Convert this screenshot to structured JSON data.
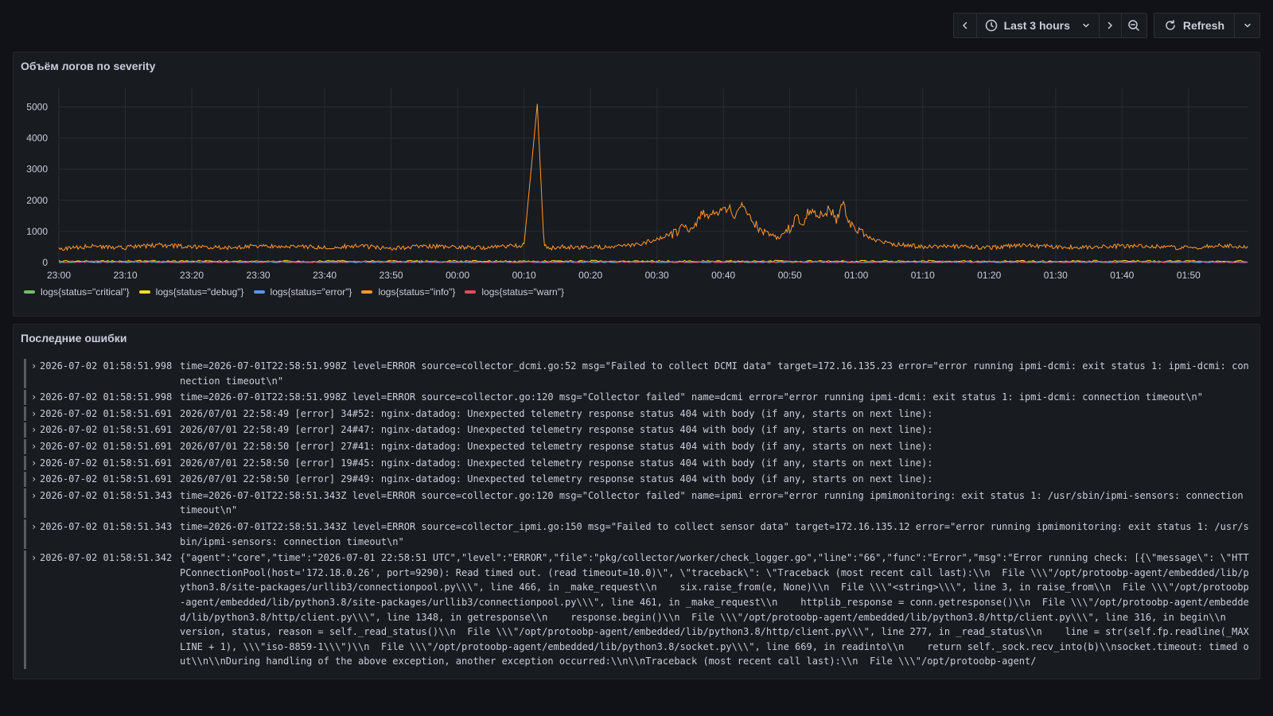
{
  "toolbar": {
    "time_range": "Last 3 hours",
    "refresh_label": "Refresh"
  },
  "chart_panel": {
    "title": "Объём логов по severity"
  },
  "chart_data": {
    "type": "line",
    "x_ticks": [
      "23:00",
      "23:10",
      "23:20",
      "23:30",
      "23:40",
      "23:50",
      "00:00",
      "00:10",
      "00:20",
      "00:30",
      "00:40",
      "00:50",
      "01:00",
      "01:10",
      "01:20",
      "01:30",
      "01:40",
      "01:50"
    ],
    "y_ticks": [
      0,
      1000,
      2000,
      3000,
      4000,
      5000
    ],
    "ylim": [
      0,
      5600
    ],
    "x_range_minutes": [
      0,
      179
    ],
    "grid": true,
    "legend_position": "bottom-left",
    "series": [
      {
        "name": "logs{status=\"critical\"}",
        "color": "#73bf69",
        "x_min": [
          0,
          179
        ],
        "values_level": [
          15,
          15
        ]
      },
      {
        "name": "logs{status=\"debug\"}",
        "color": "#fade2a",
        "x_min": [
          0,
          179
        ],
        "values_level": [
          40,
          40
        ]
      },
      {
        "name": "logs{status=\"error\"}",
        "color": "#5794f2",
        "x_min": [
          0,
          179
        ],
        "values_level": [
          10,
          10
        ]
      },
      {
        "name": "logs{status=\"info\"}",
        "color": "#ff9830",
        "x_min": [
          0,
          5,
          10,
          15,
          20,
          25,
          30,
          35,
          40,
          45,
          50,
          55,
          60,
          65,
          70,
          72,
          73,
          74,
          75,
          80,
          85,
          88,
          90,
          92,
          94,
          95,
          96,
          97,
          98,
          100,
          101,
          102,
          103,
          104,
          105,
          106,
          107,
          108,
          109,
          110,
          111,
          112,
          113,
          114,
          115,
          116,
          117,
          118,
          119,
          120,
          121,
          122,
          123,
          125,
          128,
          130,
          135,
          140,
          145,
          150,
          155,
          160,
          165,
          170,
          175,
          179
        ],
        "values": [
          450,
          520,
          480,
          560,
          500,
          470,
          540,
          510,
          490,
          530,
          460,
          520,
          500,
          480,
          560,
          5100,
          520,
          470,
          500,
          480,
          520,
          620,
          750,
          900,
          1100,
          1000,
          1300,
          1600,
          1450,
          1800,
          1700,
          1500,
          1850,
          1400,
          1200,
          900,
          1000,
          800,
          900,
          1100,
          1500,
          1300,
          1700,
          1600,
          1500,
          1750,
          1400,
          1850,
          1300,
          1000,
          900,
          800,
          700,
          600,
          550,
          500,
          520,
          480,
          560,
          500,
          490,
          530,
          510,
          470,
          540,
          500
        ]
      },
      {
        "name": "logs{status=\"warn\"}",
        "color": "#f2495c",
        "x_min": [
          0,
          179
        ],
        "values_level": [
          25,
          25
        ]
      }
    ]
  },
  "logs_panel": {
    "title": "Последние ошибки",
    "rows": [
      {
        "ts": "2026-07-02 01:58:51.998",
        "msg": "time=2026-07-01T22:58:51.998Z level=ERROR source=collector_dcmi.go:52 msg=\"Failed to collect DCMI data\" target=172.16.135.23 error=\"error running ipmi-dcmi: exit status 1: ipmi-dcmi: connection timeout\\n\""
      },
      {
        "ts": "2026-07-02 01:58:51.998",
        "msg": "time=2026-07-01T22:58:51.998Z level=ERROR source=collector.go:120 msg=\"Collector failed\" name=dcmi error=\"error running ipmi-dcmi: exit status 1: ipmi-dcmi: connection timeout\\n\""
      },
      {
        "ts": "2026-07-02 01:58:51.691",
        "msg": "2026/07/01 22:58:49 [error] 34#52: nginx-datadog: Unexpected telemetry response status 404 with body (if any, starts on next line):"
      },
      {
        "ts": "2026-07-02 01:58:51.691",
        "msg": "2026/07/01 22:58:49 [error] 24#47: nginx-datadog: Unexpected telemetry response status 404 with body (if any, starts on next line):"
      },
      {
        "ts": "2026-07-02 01:58:51.691",
        "msg": "2026/07/01 22:58:50 [error] 27#41: nginx-datadog: Unexpected telemetry response status 404 with body (if any, starts on next line):"
      },
      {
        "ts": "2026-07-02 01:58:51.691",
        "msg": "2026/07/01 22:58:50 [error] 19#45: nginx-datadog: Unexpected telemetry response status 404 with body (if any, starts on next line):"
      },
      {
        "ts": "2026-07-02 01:58:51.691",
        "msg": "2026/07/01 22:58:50 [error] 29#49: nginx-datadog: Unexpected telemetry response status 404 with body (if any, starts on next line):"
      },
      {
        "ts": "2026-07-02 01:58:51.343",
        "msg": "time=2026-07-01T22:58:51.343Z level=ERROR source=collector.go:120 msg=\"Collector failed\" name=ipmi error=\"error running ipmimonitoring: exit status 1: /usr/sbin/ipmi-sensors: connection timeout\\n\""
      },
      {
        "ts": "2026-07-02 01:58:51.343",
        "msg": "time=2026-07-01T22:58:51.343Z level=ERROR source=collector_ipmi.go:150 msg=\"Failed to collect sensor data\" target=172.16.135.12 error=\"error running ipmimonitoring: exit status 1: /usr/sbin/ipmi-sensors: connection timeout\\n\""
      },
      {
        "ts": "2026-07-02 01:58:51.342",
        "msg": "{\"agent\":\"core\",\"time\":\"2026-07-01 22:58:51 UTC\",\"level\":\"ERROR\",\"file\":\"pkg/collector/worker/check_logger.go\",\"line\":\"66\",\"func\":\"Error\",\"msg\":\"Error running check: [{\\\"message\\\": \\\"HTTPConnectionPool(host='172.18.0.26', port=9290): Read timed out. (read timeout=10.0)\\\", \\\"traceback\\\": \\\"Traceback (most recent call last):\\\\n  File \\\\\\\"/opt/protoobp-agent/embedded/lib/python3.8/site-packages/urllib3/connectionpool.py\\\\\\\", line 466, in _make_request\\\\n    six.raise_from(e, None)\\\\n  File \\\\\\\"<string>\\\\\\\", line 3, in raise_from\\\\n  File \\\\\\\"/opt/protoobp-agent/embedded/lib/python3.8/site-packages/urllib3/connectionpool.py\\\\\\\", line 461, in _make_request\\\\n    httplib_response = conn.getresponse()\\\\n  File \\\\\\\"/opt/protoobp-agent/embedded/lib/python3.8/http/client.py\\\\\\\", line 1348, in getresponse\\\\n    response.begin()\\\\n  File \\\\\\\"/opt/protoobp-agent/embedded/lib/python3.8/http/client.py\\\\\\\", line 316, in begin\\\\n    version, status, reason = self._read_status()\\\\n  File \\\\\\\"/opt/protoobp-agent/embedded/lib/python3.8/http/client.py\\\\\\\", line 277, in _read_status\\\\n    line = str(self.fp.readline(_MAXLINE + 1), \\\\\\\"iso-8859-1\\\\\\\")\\\\n  File \\\\\\\"/opt/protoobp-agent/embedded/lib/python3.8/socket.py\\\\\\\", line 669, in readinto\\\\n    return self._sock.recv_into(b)\\\\nsocket.timeout: timed out\\\\n\\\\nDuring handling of the above exception, another exception occurred:\\\\n\\\\nTraceback (most recent call last):\\\\n  File \\\\\\\"/opt/protoobp-agent/"
      }
    ]
  }
}
